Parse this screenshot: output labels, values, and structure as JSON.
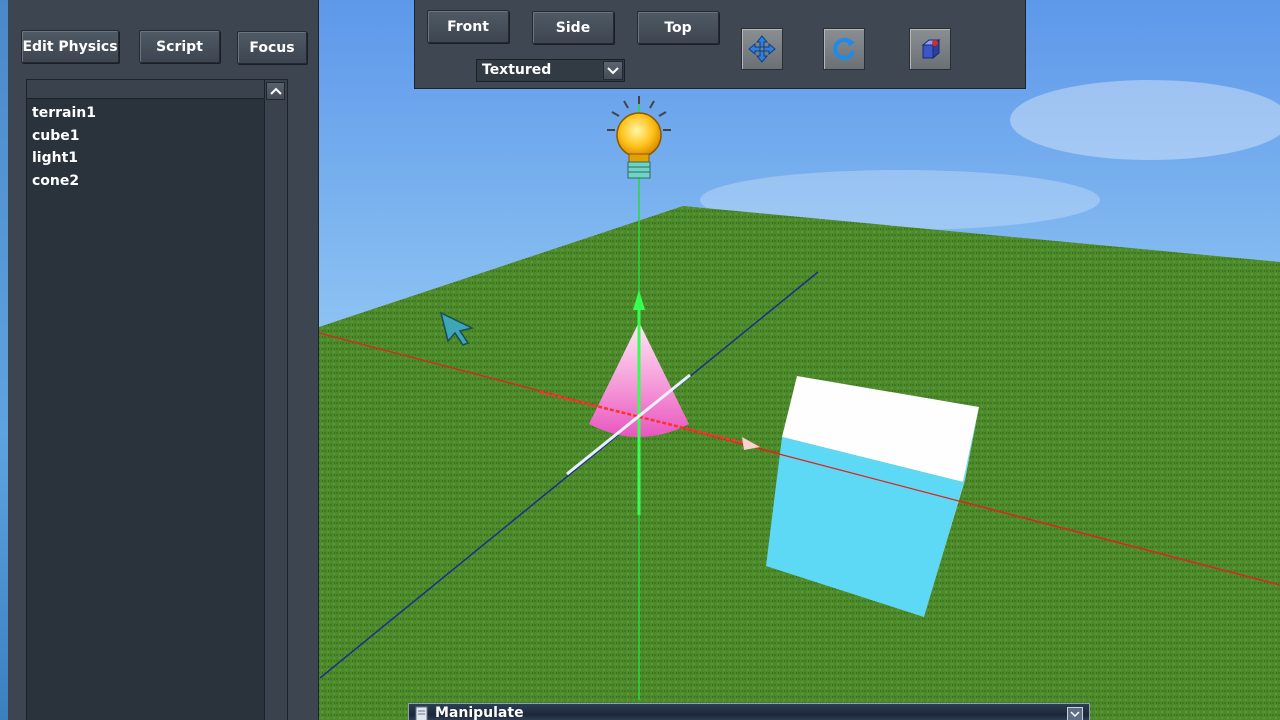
{
  "left_panel": {
    "buttons": {
      "edit_physics": "Edit Physics",
      "script": "Script",
      "focus": "Focus"
    },
    "scene_objects": [
      "terrain1",
      "cube1",
      "light1",
      "cone2"
    ]
  },
  "toolbar": {
    "views": {
      "front": "Front",
      "side": "Side",
      "top": "Top"
    },
    "render_mode": "Textured",
    "tools": [
      "move-icon",
      "rotate-icon",
      "scale-icon"
    ]
  },
  "bottom_window": {
    "title": "Manipulate"
  },
  "colors": {
    "panel_bg": "#3d4650",
    "list_bg": "#2a323c",
    "sky_top": "#5b93e6",
    "ground": "#4f8a2c",
    "axis_x": "#e0231f",
    "axis_y": "#19e33a",
    "axis_z": "#1c2e8c",
    "cube_side": "#5ed9f5",
    "cone": "#f26cc8"
  }
}
